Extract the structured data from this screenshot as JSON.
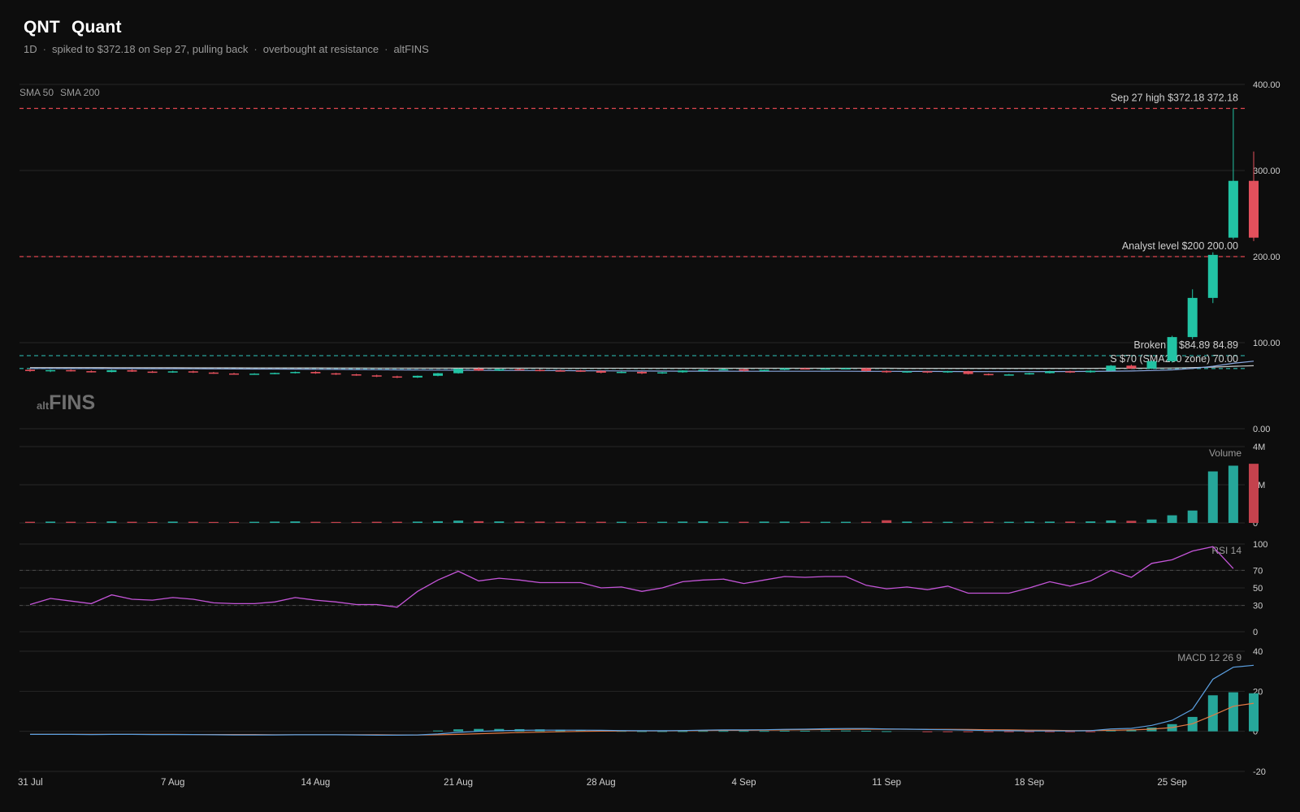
{
  "header": {
    "ticker": "QNT",
    "name": "Quant",
    "timeframe": "1D",
    "note1": "spiked to $372.18 on Sep 27, pulling back",
    "note2": "overbought at resistance",
    "source": "altFINS"
  },
  "watermark": {
    "brand": "altFINS",
    "prefix": "alt",
    "main": "FINS"
  },
  "colors": {
    "background": "#0d0d0d",
    "up": "#26a69a",
    "up_bright": "#22c3a4",
    "down": "#e2505c",
    "resistance": "#e0454f",
    "support": "#2aa198",
    "sma50": "#8aa8e0",
    "sma200": "#c8c8c8",
    "rsi": "#c455d8",
    "macd": "#5b9fe0",
    "signal": "#e07a45",
    "grid": "#262626"
  },
  "chart_data": [
    {
      "type": "candlestick",
      "pane": "price",
      "legend": [
        "SMA 50",
        "SMA 200"
      ],
      "ylim": [
        0,
        400
      ],
      "yticks": [
        0,
        100,
        200,
        300,
        400
      ],
      "ytick_labels": [
        "0.00",
        "100.00",
        "200.00",
        "300.00",
        "400.00"
      ],
      "x_labels": [
        "31 Jul",
        "7 Aug",
        "14 Aug",
        "21 Aug",
        "28 Aug",
        "4 Sep",
        "11 Sep",
        "18 Sep",
        "25 Sep"
      ],
      "x_label_index": [
        0,
        7,
        14,
        21,
        28,
        35,
        42,
        49,
        56
      ],
      "ohlc": [
        [
          68.5,
          69.8,
          66.2,
          67.0
        ],
        [
          67.0,
          68.6,
          65.8,
          68.1
        ],
        [
          68.1,
          69.0,
          66.4,
          66.9
        ],
        [
          66.9,
          67.8,
          65.3,
          65.9
        ],
        [
          65.9,
          68.5,
          65.5,
          68.0
        ],
        [
          68.0,
          69.0,
          66.0,
          66.4
        ],
        [
          66.4,
          67.2,
          64.9,
          65.5
        ],
        [
          65.5,
          67.4,
          65.0,
          66.7
        ],
        [
          66.7,
          67.5,
          64.8,
          65.3
        ],
        [
          65.3,
          66.0,
          63.8,
          64.2
        ],
        [
          64.2,
          65.0,
          63.0,
          63.5
        ],
        [
          63.5,
          64.5,
          62.8,
          64.0
        ],
        [
          64.0,
          65.2,
          63.2,
          64.8
        ],
        [
          64.8,
          66.5,
          64.2,
          66.0
        ],
        [
          66.0,
          66.8,
          63.8,
          64.4
        ],
        [
          64.4,
          65.0,
          62.5,
          63.2
        ],
        [
          63.2,
          63.8,
          61.5,
          62.0
        ],
        [
          62.0,
          62.8,
          60.0,
          60.8
        ],
        [
          60.8,
          61.6,
          58.8,
          59.5
        ],
        [
          59.5,
          61.8,
          59.0,
          61.5
        ],
        [
          61.5,
          64.8,
          61.0,
          64.5
        ],
        [
          64.5,
          70.2,
          64.0,
          69.8
        ],
        [
          69.8,
          71.5,
          67.0,
          67.5
        ],
        [
          67.5,
          70.0,
          67.0,
          69.2
        ],
        [
          69.2,
          70.0,
          67.8,
          68.3
        ],
        [
          68.3,
          69.5,
          66.8,
          67.7
        ],
        [
          67.7,
          68.7,
          66.5,
          67.6
        ],
        [
          67.6,
          68.5,
          66.0,
          67.2
        ],
        [
          67.2,
          68.0,
          64.3,
          65.1
        ],
        [
          65.1,
          66.8,
          64.5,
          66.1
        ],
        [
          66.1,
          66.8,
          63.5,
          64.3
        ],
        [
          64.3,
          66.0,
          63.8,
          65.6
        ],
        [
          65.6,
          68.0,
          65.0,
          67.7
        ],
        [
          67.7,
          69.0,
          67.0,
          68.5
        ],
        [
          68.5,
          70.0,
          68.0,
          69.2
        ],
        [
          69.2,
          70.0,
          66.5,
          67.4
        ],
        [
          67.4,
          68.9,
          66.8,
          68.4
        ],
        [
          68.4,
          70.8,
          68.0,
          70.2
        ],
        [
          70.2,
          71.0,
          68.9,
          69.6
        ],
        [
          69.6,
          70.6,
          69.0,
          70.0
        ],
        [
          70.0,
          70.9,
          69.2,
          70.3
        ],
        [
          70.3,
          70.9,
          66.4,
          67.1
        ],
        [
          67.1,
          67.8,
          64.9,
          65.6
        ],
        [
          65.6,
          67.1,
          65.0,
          66.7
        ],
        [
          66.7,
          67.2,
          64.7,
          65.4
        ],
        [
          65.4,
          67.2,
          65.0,
          66.8
        ],
        [
          66.8,
          67.3,
          63.0,
          63.6
        ],
        [
          63.6,
          64.2,
          62.0,
          62.9
        ],
        [
          62.9,
          63.6,
          62.3,
          63.1
        ],
        [
          63.1,
          65.1,
          62.8,
          64.6
        ],
        [
          64.6,
          67.3,
          64.2,
          66.7
        ],
        [
          66.7,
          67.4,
          64.8,
          65.6
        ],
        [
          65.6,
          68.0,
          65.0,
          67.4
        ],
        [
          67.4,
          74.0,
          67.0,
          73.3
        ],
        [
          73.3,
          74.5,
          69.5,
          70.0
        ],
        [
          70.0,
          79.5,
          69.5,
          78.5
        ],
        [
          78.5,
          108.0,
          77.0,
          106.5
        ],
        [
          106.5,
          162.0,
          104.0,
          152.0
        ],
        [
          152.0,
          205.0,
          146.0,
          202.0
        ],
        [
          222.0,
          372.18,
          220.0,
          288.0
        ],
        [
          288.0,
          322.0,
          218.0,
          222.0
        ]
      ],
      "sma50": [
        70.0,
        70.0,
        69.9,
        69.9,
        69.8,
        69.8,
        69.7,
        69.7,
        69.6,
        69.5,
        69.4,
        69.3,
        69.3,
        69.2,
        69.1,
        69.0,
        68.8,
        68.6,
        68.4,
        68.2,
        68.1,
        68.0,
        67.9,
        67.8,
        67.7,
        67.6,
        67.5,
        67.4,
        67.3,
        67.2,
        67.1,
        67.0,
        66.9,
        66.9,
        66.9,
        66.8,
        66.8,
        66.8,
        66.8,
        66.8,
        66.8,
        66.7,
        66.7,
        66.6,
        66.6,
        66.5,
        66.4,
        66.3,
        66.3,
        66.3,
        66.4,
        66.5,
        66.6,
        66.9,
        67.1,
        67.6,
        68.4,
        70.0,
        72.5,
        76.0,
        78.5
      ],
      "sma200": [
        71.0,
        71.0,
        71.0,
        71.0,
        70.9,
        70.9,
        70.9,
        70.9,
        70.8,
        70.8,
        70.8,
        70.7,
        70.7,
        70.7,
        70.7,
        70.6,
        70.6,
        70.5,
        70.5,
        70.4,
        70.4,
        70.4,
        70.4,
        70.4,
        70.4,
        70.4,
        70.3,
        70.3,
        70.3,
        70.3,
        70.3,
        70.3,
        70.3,
        70.3,
        70.3,
        70.3,
        70.3,
        70.3,
        70.3,
        70.3,
        70.3,
        70.3,
        70.3,
        70.2,
        70.2,
        70.2,
        70.2,
        70.2,
        70.2,
        70.2,
        70.2,
        70.2,
        70.2,
        70.3,
        70.3,
        70.4,
        70.6,
        71.0,
        71.6,
        72.5,
        73.2
      ],
      "levels": [
        {
          "label": "Sep 27 high $372.18",
          "value": 372.18,
          "value_label": "372.18",
          "color": "#e0454f"
        },
        {
          "label": "Analyst level $200",
          "value": 200.0,
          "value_label": "200.00",
          "color": "#e0454f"
        },
        {
          "label": "Broken R $84.89",
          "value": 84.89,
          "value_label": "84.89",
          "color": "#2aa198"
        },
        {
          "label": "S $70 (SMA200 zone)",
          "value": 70.0,
          "value_label": "70.00",
          "color": "#2aa198"
        }
      ]
    },
    {
      "type": "bar",
      "pane": "volume",
      "title": "Volume",
      "ylim": [
        0,
        4000000
      ],
      "yticks": [
        0,
        2000000,
        4000000
      ],
      "ytick_labels": [
        "0",
        "2M",
        "4M"
      ],
      "values": [
        60000,
        70000,
        60000,
        50000,
        80000,
        60000,
        50000,
        70000,
        60000,
        50000,
        50000,
        60000,
        70000,
        80000,
        60000,
        50000,
        50000,
        60000,
        60000,
        70000,
        90000,
        120000,
        90000,
        80000,
        70000,
        70000,
        60000,
        60000,
        60000,
        60000,
        50000,
        60000,
        70000,
        80000,
        60000,
        60000,
        70000,
        70000,
        60000,
        60000,
        60000,
        60000,
        140000,
        70000,
        60000,
        60000,
        60000,
        60000,
        60000,
        70000,
        70000,
        70000,
        80000,
        130000,
        110000,
        180000,
        400000,
        650000,
        2700000,
        3000000,
        3100000
      ]
    },
    {
      "type": "line",
      "pane": "rsi",
      "title": "RSI 14",
      "ylim": [
        0,
        100
      ],
      "yticks": [
        0,
        30,
        50,
        70,
        100
      ],
      "ytick_labels": [
        "0",
        "30",
        "50",
        "70",
        "100"
      ],
      "reference_lines": [
        70,
        30
      ],
      "values": [
        31,
        38,
        35,
        32,
        42,
        37,
        36,
        39,
        37,
        33,
        32,
        32,
        34,
        39,
        36,
        34,
        31,
        31,
        28,
        46,
        59,
        69,
        58,
        61,
        59,
        56,
        56,
        56,
        50,
        51,
        46,
        50,
        57,
        59,
        60,
        55,
        59,
        63,
        62,
        63,
        63,
        53,
        49,
        51,
        48,
        52,
        44,
        44,
        44,
        50,
        57,
        52,
        58,
        70,
        62,
        78,
        82,
        92,
        97,
        72
      ]
    },
    {
      "type": "bar+line",
      "pane": "macd",
      "title": "MACD 12 26 9",
      "ylim": [
        -20,
        40
      ],
      "yticks": [
        -20,
        0,
        20,
        40
      ],
      "ytick_labels": [
        "-20",
        "0",
        "20",
        "40"
      ],
      "macd": [
        -1.5,
        -1.5,
        -1.5,
        -1.6,
        -1.5,
        -1.5,
        -1.6,
        -1.6,
        -1.6,
        -1.7,
        -1.8,
        -1.8,
        -1.8,
        -1.7,
        -1.7,
        -1.7,
        -1.8,
        -1.9,
        -1.9,
        -1.8,
        -1.3,
        -0.5,
        0.0,
        0.3,
        0.5,
        0.6,
        0.6,
        0.6,
        0.5,
        0.4,
        0.3,
        0.3,
        0.4,
        0.6,
        0.7,
        0.7,
        0.8,
        1.0,
        1.1,
        1.3,
        1.4,
        1.4,
        1.2,
        1.1,
        0.9,
        0.8,
        0.6,
        0.4,
        0.3,
        0.2,
        0.2,
        0.2,
        0.3,
        1.2,
        1.5,
        3.0,
        5.5,
        11.0,
        26.0,
        32.0,
        33.0
      ],
      "signal": [
        -1.5,
        -1.5,
        -1.5,
        -1.5,
        -1.5,
        -1.5,
        -1.5,
        -1.5,
        -1.6,
        -1.6,
        -1.6,
        -1.6,
        -1.7,
        -1.7,
        -1.7,
        -1.7,
        -1.7,
        -1.7,
        -1.8,
        -1.8,
        -1.7,
        -1.5,
        -1.2,
        -0.9,
        -0.6,
        -0.4,
        -0.2,
        0.0,
        0.1,
        0.2,
        0.2,
        0.2,
        0.3,
        0.4,
        0.5,
        0.5,
        0.6,
        0.7,
        0.8,
        0.9,
        1.0,
        1.1,
        1.1,
        1.1,
        1.0,
        1.0,
        0.9,
        0.8,
        0.7,
        0.6,
        0.5,
        0.4,
        0.4,
        0.5,
        0.7,
        1.1,
        1.9,
        3.8,
        8.0,
        12.5,
        14.0
      ],
      "hist": [
        0,
        0,
        0,
        0,
        0,
        0,
        0,
        0,
        0,
        0,
        0,
        0,
        0,
        0,
        0,
        0,
        0,
        0,
        0,
        0,
        0.4,
        1.0,
        1.2,
        1.2,
        1.1,
        1.0,
        0.8,
        0.6,
        0.4,
        0.2,
        0.1,
        0.1,
        0.1,
        0.2,
        0.2,
        0.2,
        0.2,
        0.3,
        0.3,
        0.4,
        0.4,
        0.3,
        0.1,
        0,
        -0.1,
        -0.2,
        -0.3,
        -0.4,
        -0.4,
        -0.4,
        -0.3,
        -0.2,
        -0.1,
        0.7,
        0.8,
        1.9,
        3.6,
        7.2,
        18.0,
        19.5,
        19.0
      ]
    }
  ]
}
